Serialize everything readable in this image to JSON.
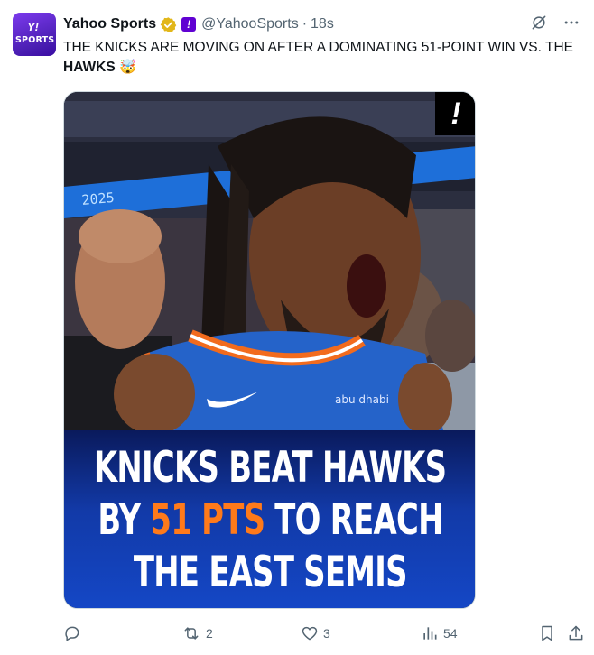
{
  "tweet": {
    "display_name": "Yahoo Sports",
    "handle": "@YahooSports",
    "separator": "·",
    "time": "18s",
    "text_prefix": "THE KNICKS ARE MOVING ON AFTER A DOMINATING 51-POINT WIN VS. THE ",
    "text_bold": "HAWKS",
    "text_emoji": "🤯",
    "avatar": {
      "logo_text": "SPORTS",
      "colors": [
        "#7c3aed",
        "#3a0ca3"
      ]
    }
  },
  "media": {
    "headline": {
      "line1": "KNICKS BEAT HAWKS",
      "line2_pre": "BY ",
      "line2_highlight": "51 PTS",
      "line2_post": " TO REACH",
      "line3": "THE EAST SEMIS"
    },
    "bang_label": "!",
    "jersey_text": "abu dhabi",
    "scoreboard_text": "2025",
    "highlight_color": "#ff7a1a",
    "banner_color": "#1447c6"
  },
  "actions": {
    "reply": {
      "icon": "reply-icon",
      "count": ""
    },
    "retweet": {
      "icon": "retweet-icon",
      "count": "2"
    },
    "like": {
      "icon": "heart-icon",
      "count": "3"
    },
    "views": {
      "icon": "views-icon",
      "count": "54"
    },
    "bookmark": {
      "icon": "bookmark-icon"
    },
    "share": {
      "icon": "share-icon"
    }
  },
  "top_actions": {
    "grok": {
      "icon": "grok-icon"
    },
    "more": {
      "icon": "more-icon"
    }
  }
}
